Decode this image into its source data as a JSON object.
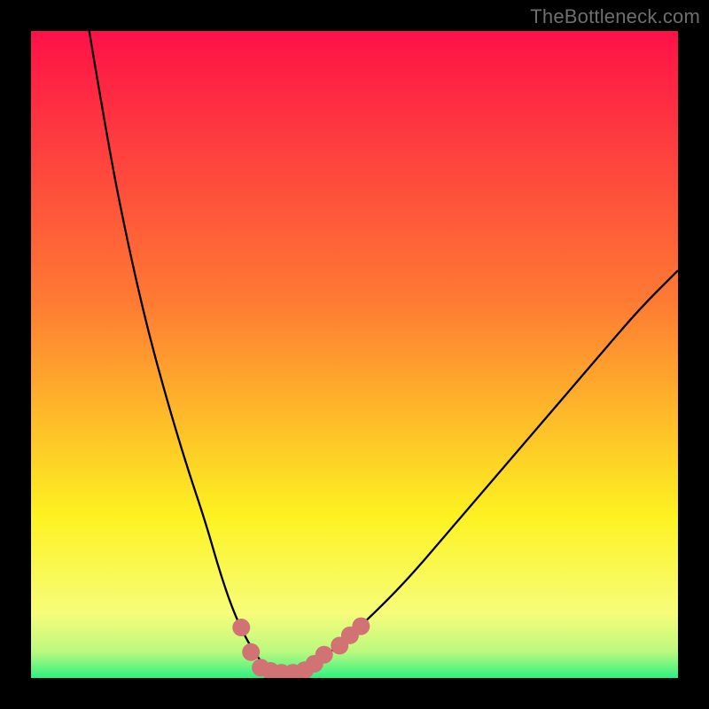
{
  "watermark": "TheBottleneck.com",
  "colors": {
    "top": "#fe1147",
    "mid1": "#fe7b33",
    "mid2": "#fdf221",
    "lowband": "#f7fd7a",
    "green": "#2df281",
    "curve": "#000000",
    "dots": "#d27373"
  },
  "chart_data": {
    "type": "line",
    "title": "",
    "xlabel": "",
    "ylabel": "",
    "xlim": [
      0,
      100
    ],
    "ylim": [
      0,
      100
    ],
    "series": [
      {
        "name": "bottleneck-curve",
        "x": [
          9,
          12,
          15,
          18,
          21,
          24,
          27,
          29,
          31,
          33,
          35,
          36.5,
          38,
          40,
          43,
          47,
          52,
          58,
          64,
          70,
          76,
          82,
          88,
          94,
          100
        ],
        "y": [
          100,
          82,
          67,
          54,
          43,
          33,
          24,
          17,
          11,
          6.5,
          3.2,
          1.6,
          0.6,
          0.6,
          1.8,
          4.5,
          9,
          15,
          22,
          29,
          36,
          43,
          50,
          57,
          63
        ]
      }
    ],
    "markers": {
      "name": "highlight-dots",
      "points": [
        {
          "x": 32.5,
          "y": 7.8
        },
        {
          "x": 34.0,
          "y": 4.0
        },
        {
          "x": 35.5,
          "y": 1.6
        },
        {
          "x": 37.0,
          "y": 1.1
        },
        {
          "x": 38.7,
          "y": 0.8
        },
        {
          "x": 40.5,
          "y": 0.8
        },
        {
          "x": 42.3,
          "y": 1.2
        },
        {
          "x": 43.8,
          "y": 2.2
        },
        {
          "x": 45.3,
          "y": 3.6
        },
        {
          "x": 47.7,
          "y": 5.0
        },
        {
          "x": 49.3,
          "y": 6.6
        },
        {
          "x": 51.0,
          "y": 8.0
        }
      ]
    }
  }
}
